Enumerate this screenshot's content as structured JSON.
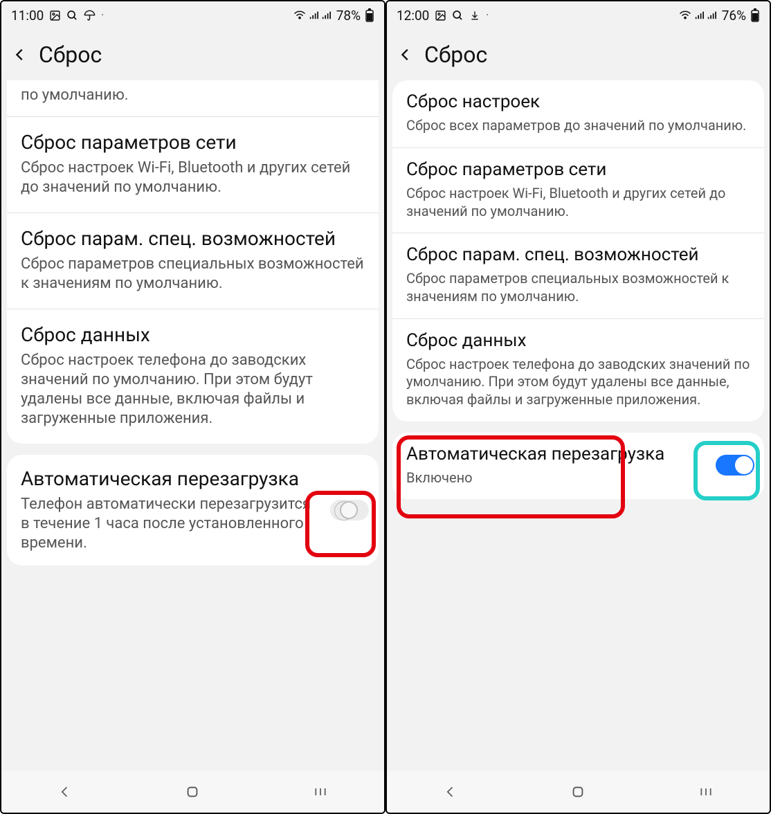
{
  "screens": [
    {
      "status": {
        "time": "11:00",
        "battery": "78%",
        "icons": [
          "image-icon",
          "search-icon",
          "umbrella-icon"
        ]
      },
      "header": {
        "title": "Сброс"
      },
      "fragment": "по умолчанию.",
      "items": [
        {
          "title": "Сброс параметров сети",
          "desc": "Сброс настроек Wi-Fi, Bluetooth и других сетей до значений по умолчанию."
        },
        {
          "title": "Сброс парам. спец. возможностей",
          "desc": "Сброс параметров специальных возможностей к значениям по умолчанию."
        },
        {
          "title": "Сброс данных",
          "desc": "Сброс настроек телефона до заводских значений по умолчанию. При этом будут удалены все данные, включая файлы и загруженные приложения."
        }
      ],
      "switch": {
        "title": "Автоматическая перезагрузка",
        "desc": "Телефон автоматически перезагрузится в течение 1 часа после установленного времени.",
        "on": false
      }
    },
    {
      "status": {
        "time": "12:00",
        "battery": "76%",
        "icons": [
          "image-icon",
          "search-icon",
          "download-icon"
        ]
      },
      "header": {
        "title": "Сброс"
      },
      "items": [
        {
          "title": "Сброс настроек",
          "desc": "Сброс всех параметров до значений по умолчанию."
        },
        {
          "title": "Сброс параметров сети",
          "desc": "Сброс настроек Wi-Fi, Bluetooth и других сетей до значений по умолчанию."
        },
        {
          "title": "Сброс парам. спец. возможностей",
          "desc": "Сброс параметров специальных возможностей к значениям по умолчанию."
        },
        {
          "title": "Сброс данных",
          "desc": "Сброс настроек телефона до заводских значений по умолчанию. При этом будут удалены все данные, включая файлы и загруженные приложения."
        }
      ],
      "switch": {
        "title": "Автоматическая перезагрузка",
        "desc": "Включено",
        "on": true
      }
    }
  ]
}
